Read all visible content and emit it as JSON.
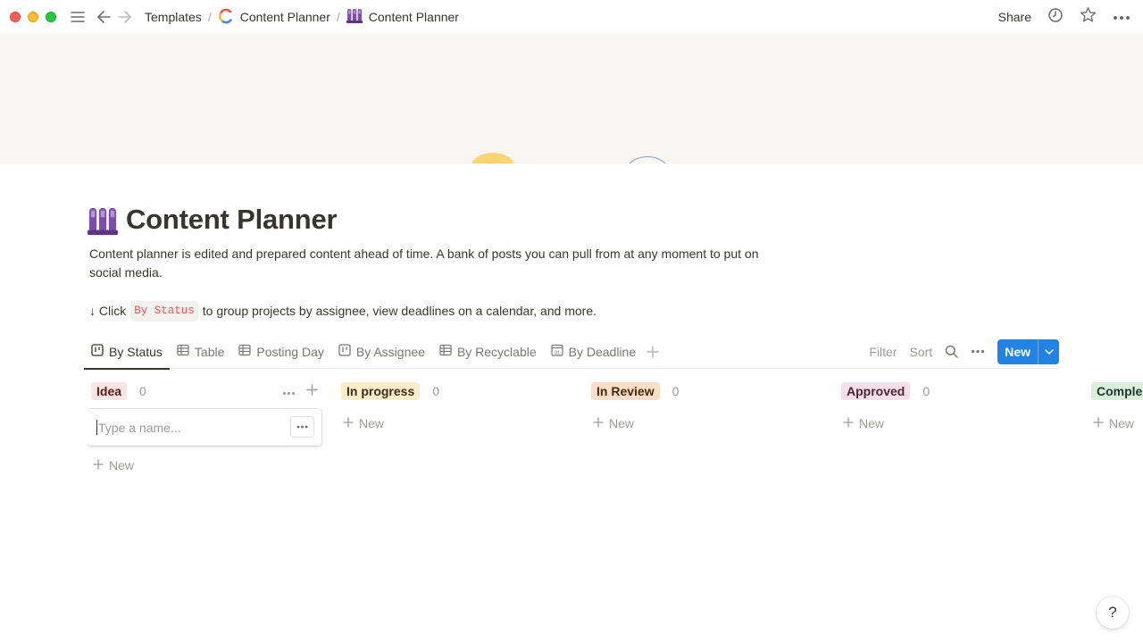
{
  "window": {
    "controls": [
      "close",
      "minimize",
      "zoom"
    ]
  },
  "topbar": {
    "breadcrumbs": [
      {
        "label": "Templates",
        "icon": ""
      },
      {
        "label": "Content Planner",
        "icon": "content-planner-logo-icon"
      },
      {
        "label": "Content Planner",
        "icon": "page-purple-icon"
      }
    ],
    "share_label": "Share",
    "icons": [
      "updates-clock-icon",
      "favorite-star-icon",
      "more-dots-icon"
    ]
  },
  "page": {
    "title": "Content Planner",
    "description": "Content planner is edited and prepared content ahead of time. A bank of posts you can pull from at any moment to put on social media.",
    "hint_prefix": "↓ Click",
    "hint_code": "By Status",
    "hint_suffix": "to group projects by assignee, view deadlines on a calendar, and more."
  },
  "views": {
    "tabs": [
      {
        "label": "By Status",
        "icon": "board-icon",
        "active": true
      },
      {
        "label": "Table",
        "icon": "table-icon",
        "active": false
      },
      {
        "label": "Posting Day",
        "icon": "table-icon",
        "active": false
      },
      {
        "label": "By Assignee",
        "icon": "board-icon",
        "active": false
      },
      {
        "label": "By Recyclable",
        "icon": "table-icon",
        "active": false
      },
      {
        "label": "By Deadline",
        "icon": "calendar-icon",
        "active": false
      }
    ],
    "filter_label": "Filter",
    "sort_label": "Sort",
    "new_label": "New"
  },
  "board": {
    "columns": [
      {
        "label": "Idea",
        "count": "0",
        "bg": "#fbe4e4",
        "fg": "#5d1715"
      },
      {
        "label": "In progress",
        "count": "0",
        "bg": "#fdecc8",
        "fg": "#402c1b"
      },
      {
        "label": "In Review",
        "count": "0",
        "bg": "#fadec9",
        "fg": "#49290e"
      },
      {
        "label": "Approved",
        "count": "0",
        "bg": "#f5e0e9",
        "fg": "#4c2337"
      },
      {
        "label": "Comple",
        "count": "",
        "bg": "#dbeddb",
        "fg": "#1c3829"
      }
    ],
    "new_label": "New",
    "card_placeholder": "Type a name..."
  },
  "help_label": "?",
  "colors": {
    "accent": "#2383e2",
    "code": "#eb5757",
    "cover": "#f7f6f3"
  }
}
